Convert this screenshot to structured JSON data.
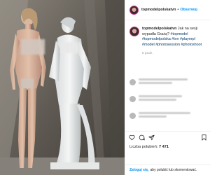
{
  "post": {
    "username": "topmodelpolskatvn",
    "follow_label": "Obserwuj",
    "separator": "•",
    "caption": {
      "username": "topmodelpolskatvn",
      "text": " Jak na sesji wypadła Grażą? ",
      "hashtags": [
        "#topmodel",
        "#topmodelpolska",
        "#tvn",
        "#playerpl",
        "#model",
        "#photosession",
        "#photoshoot"
      ]
    },
    "time_ago": "5 godz.",
    "likes_label": "Liczba polubień: ",
    "likes_count": "7 471"
  },
  "login": {
    "link": "Zaloguj się,",
    "text": "aby polubić lub skomentować."
  },
  "icons": [
    "heart-icon",
    "comment-icon",
    "share-icon",
    "bookmark-icon"
  ],
  "colors": {
    "link": "#0095f6",
    "hashtag": "#00376b",
    "muted": "#8e8e8e",
    "border": "#efefef"
  }
}
